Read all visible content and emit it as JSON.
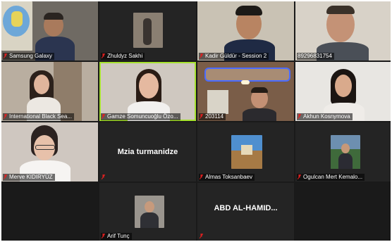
{
  "participants": [
    {
      "name": "Samsung Galaxy"
    },
    {
      "name": "Zhuldyz Sakhi"
    },
    {
      "name": "Kadir Güldür - Session 2"
    },
    {
      "name": "89296831754"
    },
    {
      "name": "International Black Sea..."
    },
    {
      "name": "Gamze Somuncuoğlu Özo..."
    },
    {
      "name": "203114"
    },
    {
      "name": "Akhun Kosnymova"
    },
    {
      "name": "Merve KIDIRYÜZ"
    },
    {
      "name": "",
      "center_text": "Mzia turmanidze"
    },
    {
      "name": "Almas Toksanbaev"
    },
    {
      "name": "Ogulcan Mert Kemalo..."
    },
    {
      "name": "Arif Tunç"
    },
    {
      "name": "",
      "center_text": "ABD  AL-HAMID..."
    }
  ],
  "colors": {
    "active_speaker_border": "#a6e22e",
    "muted_mic": "#e02020",
    "tile_bg": "#242424"
  },
  "icons": {
    "mute": "muted-mic-icon"
  }
}
